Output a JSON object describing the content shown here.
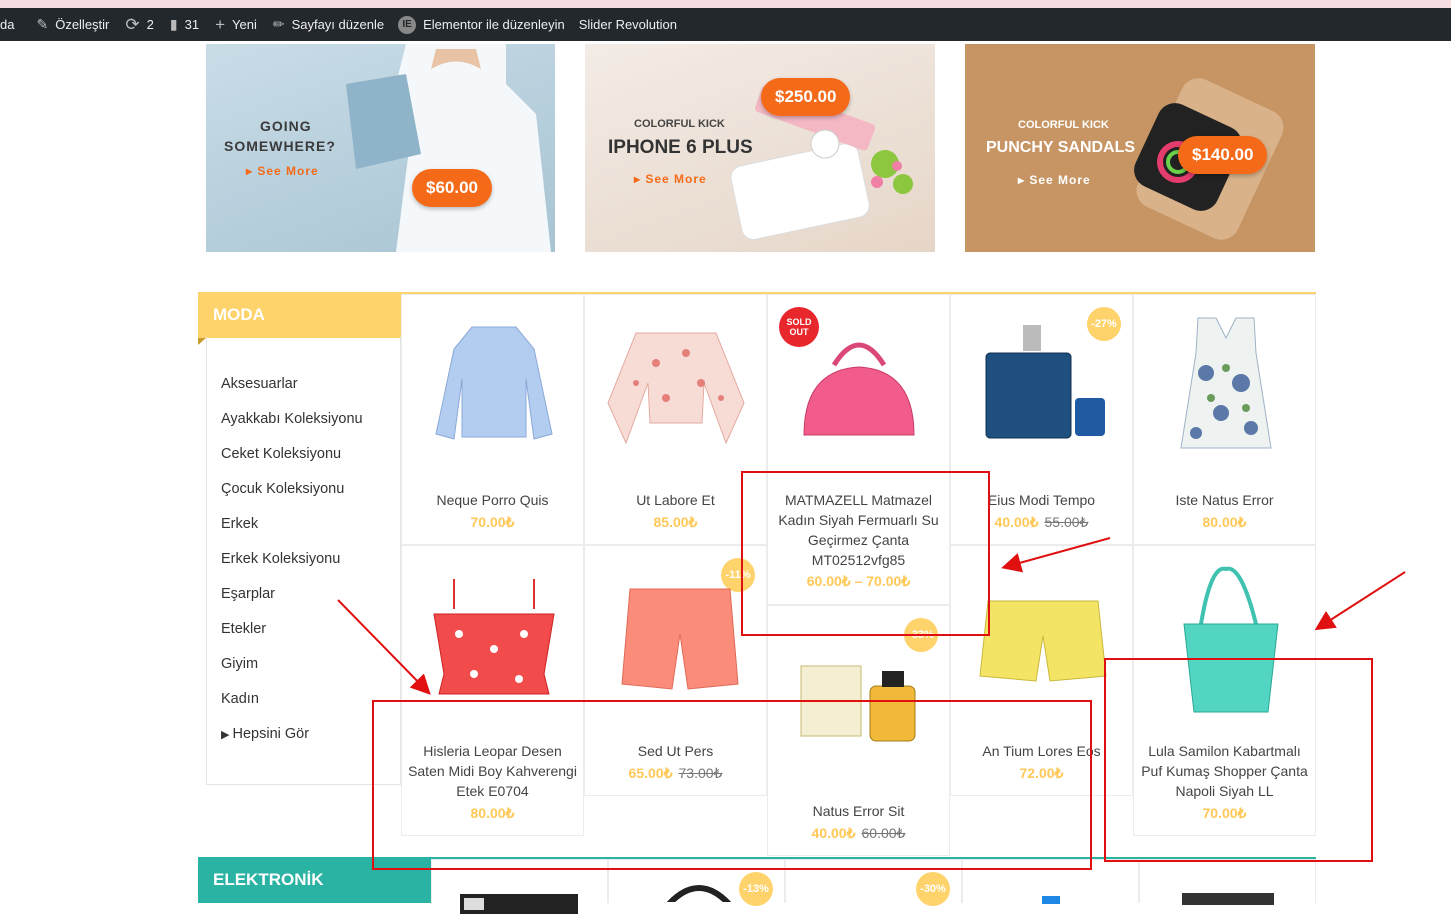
{
  "adminbar": {
    "items": [
      {
        "label": "da"
      },
      {
        "label": "Özelleştir",
        "icon": "brush-icon"
      },
      {
        "label": "2",
        "icon": "refresh-icon"
      },
      {
        "label": "31",
        "icon": "comment-icon"
      },
      {
        "label": "Yeni",
        "icon": "plus-icon"
      },
      {
        "label": "Sayfayı düzenle",
        "icon": "pencil-icon"
      },
      {
        "label": "Elementor ile düzenleyin",
        "icon": "elementor-icon"
      },
      {
        "label": "Slider Revolution"
      }
    ]
  },
  "banners": [
    {
      "line1": "GOING",
      "line2": "SOMEWHERE?",
      "see_more": "See More",
      "price": "$60.00"
    },
    {
      "kicker": "COLORFUL KICK",
      "title": "IPHONE 6 PLUS",
      "see_more": "See More",
      "price": "$250.00"
    },
    {
      "kicker": "COLORFUL KICK",
      "title": "PUNCHY SANDALS",
      "see_more": "See More",
      "price": "$140.00"
    }
  ],
  "moda": {
    "title": "MODA",
    "categories": [
      "Aksesuarlar",
      "Ayakkabı Koleksiyonu",
      "Ceket Koleksiyonu",
      "Çocuk Koleksiyonu",
      "Erkek",
      "Erkek Koleksiyonu",
      "Eşarplar",
      "Etekler",
      "Giyim",
      "Kadın"
    ],
    "see_all": "Hepsini Gör",
    "products": [
      {
        "name": "Neque Porro Quis",
        "price": "70.00₺"
      },
      {
        "name": "Ut Labore Et",
        "price": "85.00₺"
      },
      {
        "name": "MATMAZELL Matmazel Kadın Siyah Fermuarlı Su Geçirmez Çanta MT02512vfg85",
        "price": "60.00₺ – 70.00₺",
        "badge": "SOLD OUT"
      },
      {
        "name": "Eius Modi Tempo",
        "price": "40.00₺",
        "old_price": "55.00₺",
        "badge": "-27%"
      },
      {
        "name": "Iste Natus Error",
        "price": "80.00₺"
      },
      {
        "name": "Hisleria Leopar Desen Saten Midi Boy Kahverengi Etek E0704",
        "price": "80.00₺"
      },
      {
        "name": "Sed Ut Pers",
        "price": "65.00₺",
        "old_price": "73.00₺",
        "badge": "-11%"
      },
      {
        "name": "Natus Error Sit",
        "price": "40.00₺",
        "old_price": "60.00₺",
        "badge": "-33%"
      },
      {
        "name": "An Tium Lores Eos",
        "price": "72.00₺"
      },
      {
        "name": "Lula Samilon Kabartmalı Puf Kumaş Shopper Çanta Napoli Siyah LL",
        "price": "70.00₺"
      }
    ]
  },
  "elektronik": {
    "title": "ELEKTRONİK",
    "badges": [
      "-13%",
      "-30%"
    ]
  }
}
